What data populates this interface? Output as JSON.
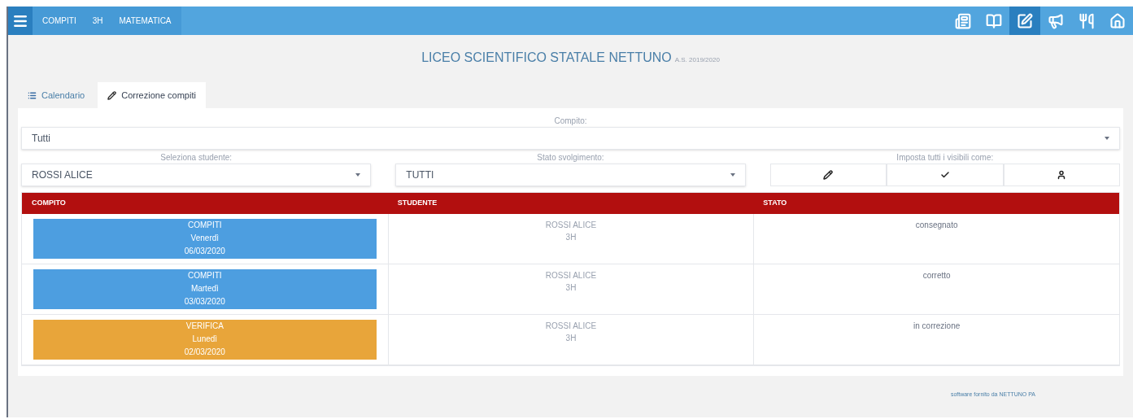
{
  "topbar": {
    "breadcrumbs": [
      "COMPITI",
      "3H",
      "MATEMATICA"
    ],
    "icons": [
      {
        "kind": "book",
        "selected": false
      },
      {
        "kind": "book2",
        "selected": false
      },
      {
        "kind": "edit",
        "selected": true
      },
      {
        "kind": "megaphone",
        "selected": false
      },
      {
        "kind": "food",
        "selected": false
      },
      {
        "kind": "home",
        "selected": false
      }
    ]
  },
  "header": {
    "school": "LICEO SCIENTIFICO STATALE NETTUNO",
    "year": "A.S. 2019/2020"
  },
  "tabs": [
    {
      "label": "Calendario",
      "kind": "calendar",
      "selected": false
    },
    {
      "label": "Correzione compiti",
      "kind": "pencil",
      "selected": true
    }
  ],
  "filters": {
    "compito_label": "Compito:",
    "compito_value": "Tutti",
    "student_label": "Seleziona studente:",
    "student_value": "ROSSI ALICE",
    "stato_label": "Stato svolgimento:",
    "stato_value": "TUTTI",
    "set_all_label": "Imposta tutti i visibili come:",
    "set_all_buttons": [
      {
        "kind": "pencil"
      },
      {
        "kind": "check"
      },
      {
        "kind": "user"
      }
    ]
  },
  "table": {
    "columns": [
      "COMPITO",
      "STUDENTE",
      "STATO"
    ],
    "rows": [
      {
        "type": "COMPITI",
        "day": "Venerdì",
        "date": "06/03/2020",
        "color": "#4d9ee0",
        "student": "ROSSI ALICE",
        "class": "3H",
        "stato": "consegnato"
      },
      {
        "type": "COMPITI",
        "day": "Martedì",
        "date": "03/03/2020",
        "color": "#4d9ee0",
        "student": "ROSSI ALICE",
        "class": "3H",
        "stato": "corretto"
      },
      {
        "type": "VERIFICA",
        "day": "Lunedì",
        "date": "02/03/2020",
        "color": "#e8a53a",
        "student": "ROSSI ALICE",
        "class": "3H",
        "stato": "in correzione"
      }
    ]
  },
  "footer": {
    "credit": "software fornito da NETTUNO PA"
  }
}
